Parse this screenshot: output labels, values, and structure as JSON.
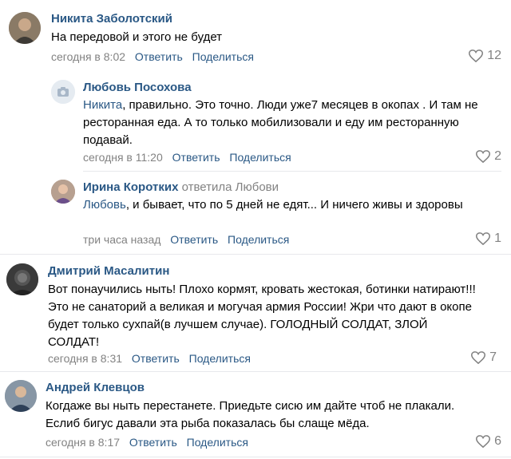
{
  "comments": [
    {
      "author": "Никита Заболотский",
      "text": "На передовой и этого не будет",
      "time": "сегодня в 8:02",
      "reply_label": "Ответить",
      "share_label": "Поделиться",
      "likes": "12",
      "avatar_icon": "user-photo"
    },
    {
      "author": "Любовь Посохова",
      "mention": "Никита",
      "text": ", правильно. Это точно. Люди уже7 месяцев в окопах . И там не ресторанная еда. А то только мобилизовали и еду им ресторанную подавай.",
      "time": "сегодня в 11:20",
      "reply_label": "Ответить",
      "share_label": "Поделиться",
      "likes": "2",
      "avatar_icon": "camera-icon"
    },
    {
      "author": "Ирина Коротких",
      "replied_to": "ответила Любови",
      "mention": "Любовь",
      "text": ", и бывает, что по 5 дней не едят... И ничего живы и здоровы",
      "time": "три часа назад",
      "reply_label": "Ответить",
      "share_label": "Поделиться",
      "likes": "1",
      "avatar_icon": "user-photo"
    },
    {
      "author": "Дмитрий Масалитин",
      "text": "Вот понаучились ныть! Плохо кормят, кровать жестокая, ботинки натирают!!! Это не санаторий а великая и могучая армия России! Жри что дают в окопе будет только сухпай(в лучшем случае). ГОЛОДНЫЙ СОЛДАТ, ЗЛОЙ СОЛДАТ!",
      "time": "сегодня в 8:31",
      "reply_label": "Ответить",
      "share_label": "Поделиться",
      "likes": "7",
      "avatar_icon": "user-photo"
    },
    {
      "author": "Андрей Клевцов",
      "text": "Когдаже вы ныть перестанете. Приедьте сисю им дайте чтоб не плакали. Еслиб бигус давали эта рыба показалась бы слаще мёда.",
      "time": "сегодня в 8:17",
      "reply_label": "Ответить",
      "share_label": "Поделиться",
      "likes": "6",
      "avatar_icon": "user-photo"
    }
  ],
  "colors": {
    "link": "#2a5885",
    "meta": "#828282",
    "divider": "#e7e8ec"
  }
}
